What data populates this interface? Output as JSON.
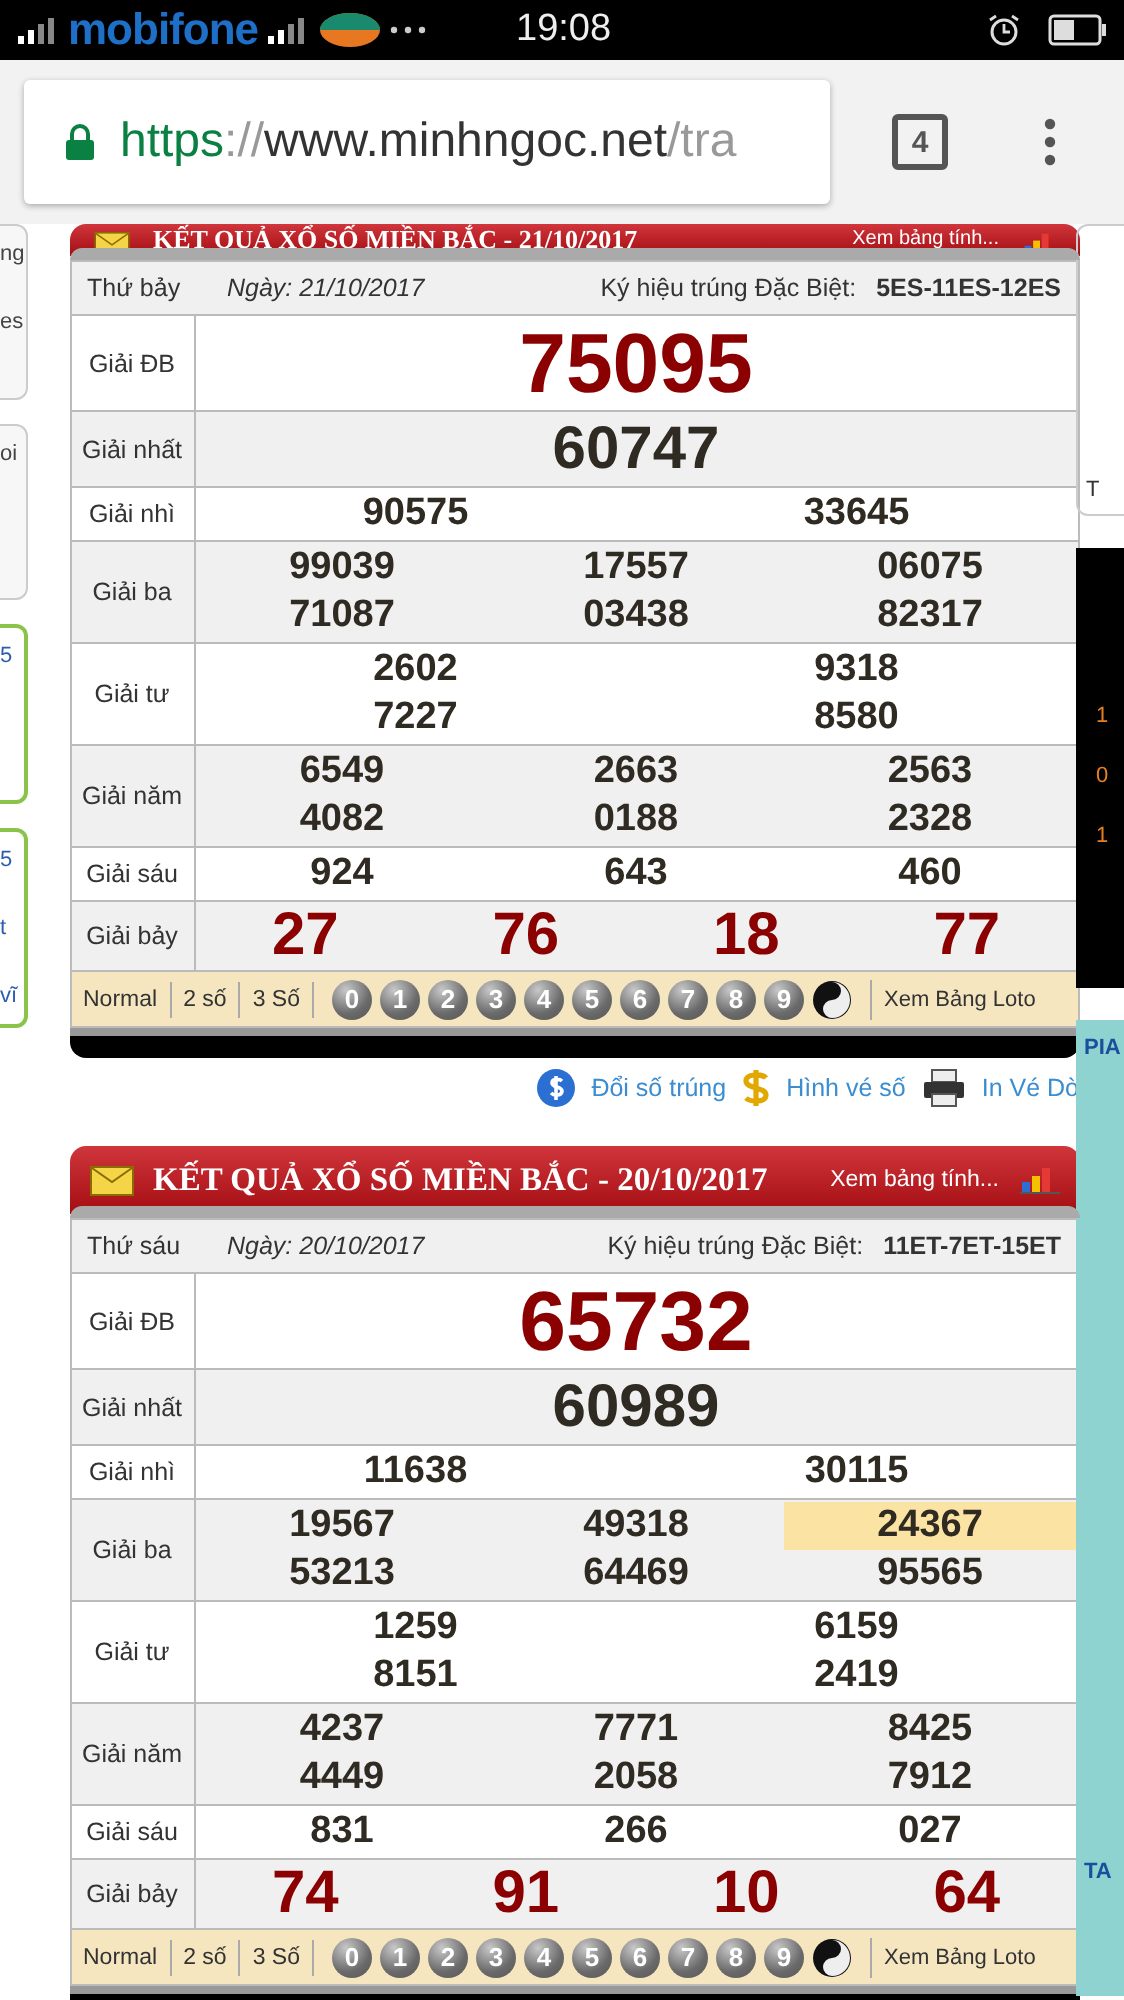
{
  "status_bar": {
    "carrier": "mobifone",
    "time": "19:08"
  },
  "browser": {
    "url_scheme": "https",
    "url_separator": "://",
    "url_host": "www.minhngoc.net",
    "url_path": "/tra",
    "tab_count": "4"
  },
  "left_edge": [
    {
      "kind": "grey",
      "texts": [
        "ng",
        "es"
      ]
    },
    {
      "kind": "grey",
      "texts": [
        "oi"
      ]
    },
    {
      "kind": "green",
      "texts": [
        "5"
      ]
    },
    {
      "kind": "green",
      "texts": [
        "5",
        "t",
        "vĩ"
      ]
    }
  ],
  "right_edge": [
    {
      "kind": "white",
      "texts": [
        "T"
      ]
    },
    {
      "kind": "dark",
      "texts": [
        "1",
        "0",
        "1"
      ]
    },
    {
      "kind": "teal",
      "texts": [
        "PIA",
        "TA"
      ]
    }
  ],
  "results": [
    {
      "title": "KẾT QUẢ XỔ SỐ MIỀN BẮC - 21/10/2017",
      "link": "Xem bảng tính...",
      "day": "Thứ bảy",
      "date": "Ngày: 21/10/2017",
      "code_label": "Ký hiệu trúng Đặc Biệt:",
      "code": "5ES-11ES-12ES",
      "prizes": [
        {
          "label": "Giải ĐB",
          "kind": "special",
          "lines": [
            [
              {
                "n": "75095",
                "highlighted": false
              }
            ]
          ]
        },
        {
          "label": "Giải nhất",
          "kind": "first",
          "lines": [
            [
              {
                "n": "60747",
                "highlighted": false
              }
            ]
          ]
        },
        {
          "label": "Giải nhì",
          "kind": "normal",
          "lines": [
            [
              {
                "n": "90575",
                "highlighted": false
              },
              {
                "n": "33645",
                "highlighted": false
              }
            ]
          ]
        },
        {
          "label": "Giải ba",
          "kind": "normal",
          "lines": [
            [
              {
                "n": "99039",
                "highlighted": false
              },
              {
                "n": "17557",
                "highlighted": false
              },
              {
                "n": "06075",
                "highlighted": false
              }
            ],
            [
              {
                "n": "71087",
                "highlighted": false
              },
              {
                "n": "03438",
                "highlighted": false
              },
              {
                "n": "82317",
                "highlighted": false
              }
            ]
          ]
        },
        {
          "label": "Giải tư",
          "kind": "normal",
          "lines": [
            [
              {
                "n": "2602",
                "highlighted": false
              },
              {
                "n": "9318",
                "highlighted": false
              }
            ],
            [
              {
                "n": "7227",
                "highlighted": false
              },
              {
                "n": "8580",
                "highlighted": false
              }
            ]
          ]
        },
        {
          "label": "Giải năm",
          "kind": "normal",
          "lines": [
            [
              {
                "n": "6549",
                "highlighted": false
              },
              {
                "n": "2663",
                "highlighted": false
              },
              {
                "n": "2563",
                "highlighted": false
              }
            ],
            [
              {
                "n": "4082",
                "highlighted": false
              },
              {
                "n": "0188",
                "highlighted": false
              },
              {
                "n": "2328",
                "highlighted": false
              }
            ]
          ]
        },
        {
          "label": "Giải sáu",
          "kind": "normal",
          "lines": [
            [
              {
                "n": "924",
                "highlighted": false
              },
              {
                "n": "643",
                "highlighted": false
              },
              {
                "n": "460",
                "highlighted": false
              }
            ]
          ]
        },
        {
          "label": "Giải bảy",
          "kind": "seventh",
          "lines": [
            [
              {
                "n": "27",
                "highlighted": false
              },
              {
                "n": "76",
                "highlighted": false
              },
              {
                "n": "18",
                "highlighted": false
              },
              {
                "n": "77",
                "highlighted": false
              }
            ]
          ]
        }
      ],
      "toolbar": {
        "modes": [
          "Normal",
          "2 số",
          "3 Số"
        ],
        "digits": [
          "0",
          "1",
          "2",
          "3",
          "4",
          "5",
          "6",
          "7",
          "8",
          "9"
        ],
        "loto": "Xem Bảng Loto"
      },
      "actions": [
        {
          "kind": "coin",
          "label": "Đổi số trúng"
        },
        {
          "kind": "dollar",
          "label": "Hình vé số"
        },
        {
          "kind": "printer",
          "label": "In Vé Dò"
        }
      ]
    },
    {
      "title": "KẾT QUẢ XỔ SỐ MIỀN BẮC - 20/10/2017",
      "link": "Xem bảng tính...",
      "day": "Thứ sáu",
      "date": "Ngày: 20/10/2017",
      "code_label": "Ký hiệu trúng Đặc Biệt:",
      "code": "11ET-7ET-15ET",
      "prizes": [
        {
          "label": "Giải ĐB",
          "kind": "special",
          "lines": [
            [
              {
                "n": "65732",
                "highlighted": false
              }
            ]
          ]
        },
        {
          "label": "Giải nhất",
          "kind": "first",
          "lines": [
            [
              {
                "n": "60989",
                "highlighted": false
              }
            ]
          ]
        },
        {
          "label": "Giải nhì",
          "kind": "normal",
          "lines": [
            [
              {
                "n": "11638",
                "highlighted": false
              },
              {
                "n": "30115",
                "highlighted": false
              }
            ]
          ]
        },
        {
          "label": "Giải ba",
          "kind": "normal",
          "lines": [
            [
              {
                "n": "19567",
                "highlighted": false
              },
              {
                "n": "49318",
                "highlighted": false
              },
              {
                "n": "24367",
                "highlighted": true
              }
            ],
            [
              {
                "n": "53213",
                "highlighted": false
              },
              {
                "n": "64469",
                "highlighted": false
              },
              {
                "n": "95565",
                "highlighted": false
              }
            ]
          ]
        },
        {
          "label": "Giải tư",
          "kind": "normal",
          "lines": [
            [
              {
                "n": "1259",
                "highlighted": false
              },
              {
                "n": "6159",
                "highlighted": false
              }
            ],
            [
              {
                "n": "8151",
                "highlighted": false
              },
              {
                "n": "2419",
                "highlighted": false
              }
            ]
          ]
        },
        {
          "label": "Giải năm",
          "kind": "normal",
          "lines": [
            [
              {
                "n": "4237",
                "highlighted": false
              },
              {
                "n": "7771",
                "highlighted": false
              },
              {
                "n": "8425",
                "highlighted": false
              }
            ],
            [
              {
                "n": "4449",
                "highlighted": false
              },
              {
                "n": "2058",
                "highlighted": false
              },
              {
                "n": "7912",
                "highlighted": false
              }
            ]
          ]
        },
        {
          "label": "Giải sáu",
          "kind": "normal",
          "lines": [
            [
              {
                "n": "831",
                "highlighted": false
              },
              {
                "n": "266",
                "highlighted": false
              },
              {
                "n": "027",
                "highlighted": false
              }
            ]
          ]
        },
        {
          "label": "Giải bảy",
          "kind": "seventh",
          "lines": [
            [
              {
                "n": "74",
                "highlighted": false
              },
              {
                "n": "91",
                "highlighted": false
              },
              {
                "n": "10",
                "highlighted": false
              },
              {
                "n": "64",
                "highlighted": false
              }
            ]
          ]
        }
      ],
      "toolbar": {
        "modes": [
          "Normal",
          "2 số",
          "3 Số"
        ],
        "digits": [
          "0",
          "1",
          "2",
          "3",
          "4",
          "5",
          "6",
          "7",
          "8",
          "9"
        ],
        "loto": "Xem Bảng Loto"
      }
    }
  ]
}
